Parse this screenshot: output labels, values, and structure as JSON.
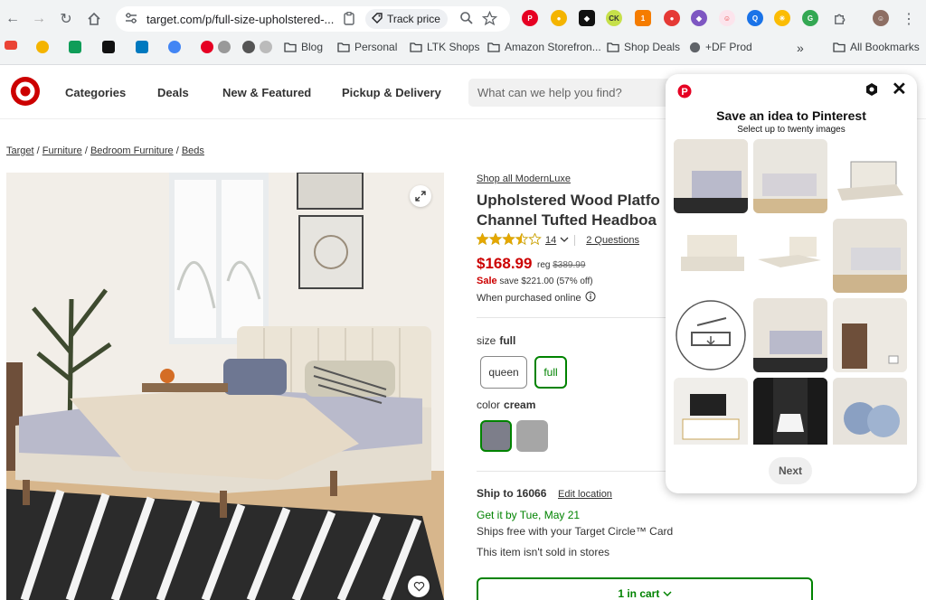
{
  "browser": {
    "url": "target.com/p/full-size-upholstered-...",
    "track_price_label": "Track price",
    "bookmarks": [
      {
        "label": "Blog"
      },
      {
        "label": "Personal"
      },
      {
        "label": "LTK Shops"
      },
      {
        "label": "Amazon Storefron..."
      },
      {
        "label": "Shop Deals"
      },
      {
        "label": "+DF Prod"
      }
    ],
    "all_bookmarks_label": "All Bookmarks",
    "more_bookmarks_label": "»"
  },
  "header": {
    "nav": [
      "Categories",
      "Deals",
      "New & Featured",
      "Pickup & Delivery"
    ],
    "search_placeholder": "What can we help you find?"
  },
  "breadcrumb": [
    "Target",
    "Furniture",
    "Bedroom Furniture",
    "Beds"
  ],
  "product": {
    "shop_all": "Shop all ModernLuxe",
    "title_line1": "Upholstered Wood Platfo",
    "title_line2": "Channel Tufted Headboa",
    "rating_count": "14",
    "questions": "2 Questions",
    "rating": 3.5,
    "price": "$168.99",
    "reg_label": "reg",
    "reg_price": "$389.99",
    "sale_label": "Sale",
    "save_text": "save $221.00 (57% off)",
    "purchased_online": "When purchased online",
    "size_label": "size",
    "size_value": "full",
    "sizes": [
      "queen",
      "full"
    ],
    "color_label": "color",
    "color_value": "cream",
    "swatch_colors": [
      "#7d7e8a",
      "#a6a6a6"
    ],
    "ship_to": "Ship to 16066",
    "edit_location": "Edit location",
    "get_it": "Get it by Tue, May 21",
    "ships_free": "Ships free with your Target Circle™ Card",
    "not_sold": "This item isn't sold in stores",
    "cart_label": "1 in cart"
  },
  "pinterest": {
    "title": "Save an idea to Pinterest",
    "subtitle": "Select up to twenty images",
    "next_label": "Next"
  },
  "colors": {
    "target_red": "#cc0000",
    "green": "#008300",
    "pinterest_red": "#e60023"
  }
}
